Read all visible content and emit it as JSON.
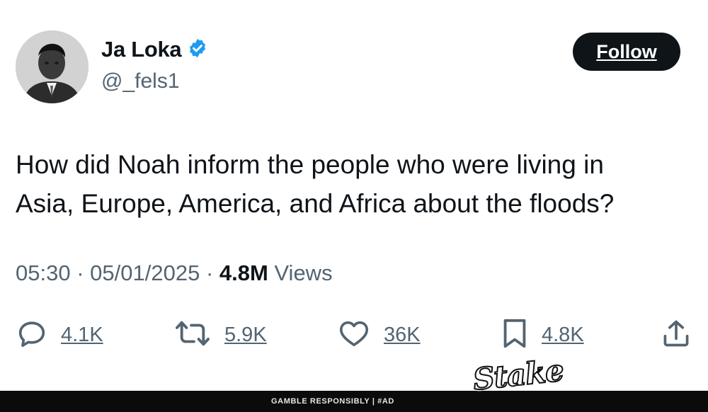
{
  "author": {
    "name": "Ja Loka",
    "handle": "@_fels1",
    "verified": true,
    "verified_color": "#1d9bf0"
  },
  "follow_button": {
    "label": "Follow"
  },
  "tweet": {
    "lines": [
      "How did Noah inform the people who were living in",
      "Asia, Europe, America, and Africa about the floods?"
    ]
  },
  "meta": {
    "time": "05:30",
    "separator": "·",
    "date": "05/01/2025",
    "views_count": "4.8M",
    "views_label": "Views"
  },
  "actions": {
    "replies": {
      "icon": "reply-icon",
      "count": "4.1K"
    },
    "reposts": {
      "icon": "repost-icon",
      "count": "5.9K"
    },
    "likes": {
      "icon": "heart-icon",
      "count": "36K"
    },
    "bookmarks": {
      "icon": "bookmark-icon",
      "count": "4.8K"
    },
    "share": {
      "icon": "share-icon"
    }
  },
  "ad": {
    "disclaimer": "GAMBLE RESPONSIBLY  |  #AD",
    "brand": "Stake"
  }
}
